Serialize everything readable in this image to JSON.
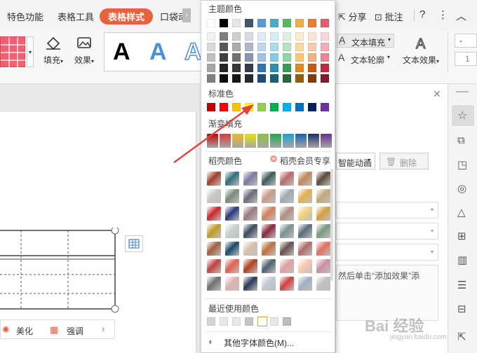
{
  "ribbon": {
    "tabs": [
      "特色功能",
      "表格工具",
      "表格样式",
      "口袋动"
    ],
    "right": {
      "share": "分享",
      "annotate": "批注",
      "help": "?"
    },
    "fill_label": "填充",
    "effect_label": "效果",
    "text_fill": "文本填充",
    "text_outline": "文本轮廓",
    "text_effect": "文本效果",
    "art_letter": "A"
  },
  "picker": {
    "theme_title": "主题颜色",
    "theme_colors": [
      [
        "#ffffff",
        "#000000",
        "#e7e6e6",
        "#44546a",
        "#5b9bd5",
        "#4bacc6",
        "#5cb85c",
        "#f0ad4e",
        "#ed7d31",
        "#e45b6a"
      ],
      [
        "#f2f2f2",
        "#7f7f7f",
        "#d0cece",
        "#d6dce4",
        "#deebf6",
        "#d5eef6",
        "#d9f1e0",
        "#fdebd1",
        "#fbe4d5",
        "#f8d6db"
      ],
      [
        "#d9d9d9",
        "#595959",
        "#aeaaaa",
        "#adb9ca",
        "#bdd7ee",
        "#acdcec",
        "#b5e3c2",
        "#fcd7a3",
        "#f7caac",
        "#f2adb7"
      ],
      [
        "#bfbfbf",
        "#404040",
        "#757070",
        "#8497b0",
        "#9cc3e5",
        "#83cbe2",
        "#90d5a3",
        "#fac475",
        "#f4b183",
        "#ec8593"
      ],
      [
        "#a6a6a6",
        "#262626",
        "#3a3838",
        "#333f50",
        "#2e75b5",
        "#2e8fb0",
        "#3a9b56",
        "#df8c1a",
        "#c55a11",
        "#c22a3d"
      ],
      [
        "#808080",
        "#0d0d0d",
        "#171616",
        "#222a35",
        "#1f4e79",
        "#1e5f75",
        "#27673a",
        "#955e11",
        "#833c0b",
        "#811c29"
      ]
    ],
    "standard_title": "标准色",
    "standard_colors": [
      "#c00000",
      "#ff0000",
      "#ffc000",
      "#ffff00",
      "#92d050",
      "#00b050",
      "#00b0f0",
      "#0070c0",
      "#002060",
      "#7030a0"
    ],
    "gradient_title": "渐变填充",
    "gradient_colors": [
      "#c00000",
      "#e0353c",
      "#f0b91e",
      "#e6e600",
      "#88c43c",
      "#1aa84f",
      "#1aa0d8",
      "#1560b0",
      "#1a2c6c",
      "#6a2c96"
    ],
    "docer_title": "稻壳颜色",
    "docer_member": "稻壳会员专享",
    "docer_colors": [
      [
        "#a0402a",
        "#2f6f7a",
        "#7a7aa0",
        "#3c5c5a",
        "#b86a6a",
        "#c0885a",
        "#5a4a3a"
      ],
      [
        "#c8c8c0",
        "#7a8a7a",
        "#6a6a7a",
        "#c89a8a",
        "#a0a8b0",
        "#e0b050",
        "#c0a878"
      ],
      [
        "#c8282a",
        "#2a3a7a",
        "#9a7a7a",
        "#d08060",
        "#b09080",
        "#f0d080",
        "#d4a040"
      ],
      [
        "#c09a2a",
        "#c8d0d0",
        "#3a4a5a",
        "#8a2a3a",
        "#7a9090",
        "#5a6a7a",
        "#7a9a80"
      ],
      [
        "#a0603a",
        "#1a4a6a",
        "#d8c0b0",
        "#c07040",
        "#6a5050",
        "#b06a6a",
        "#e07060"
      ],
      [
        "#c04040",
        "#e06050",
        "#b04020",
        "#506070",
        "#e0a0a0",
        "#f8c8b0",
        "#c890a0"
      ],
      [
        "#707070",
        "#e0b0b0",
        "#2a3a5a",
        "#c0c8d0",
        "#d04040",
        "#a0b0c0",
        "#c0c0c0"
      ]
    ],
    "recent_title": "最近使用颜色",
    "recent_colors": [
      "#d4d4d4",
      "#e8e8e8",
      "#e8e8e8",
      "#c4c4c4",
      "#ffffff",
      "#e8e8e8",
      "#bcbcbc"
    ],
    "more_colors": "其他字体颜色(M)..."
  },
  "panel": {
    "anim_label": "智能动画",
    "delete_label": "删除",
    "hint": "然后单击“添加效果”添",
    "beautify": "美化",
    "emphasize": "强调"
  },
  "watermark": "Bai 经验",
  "watermark_url": "jingyan.baidu.com"
}
